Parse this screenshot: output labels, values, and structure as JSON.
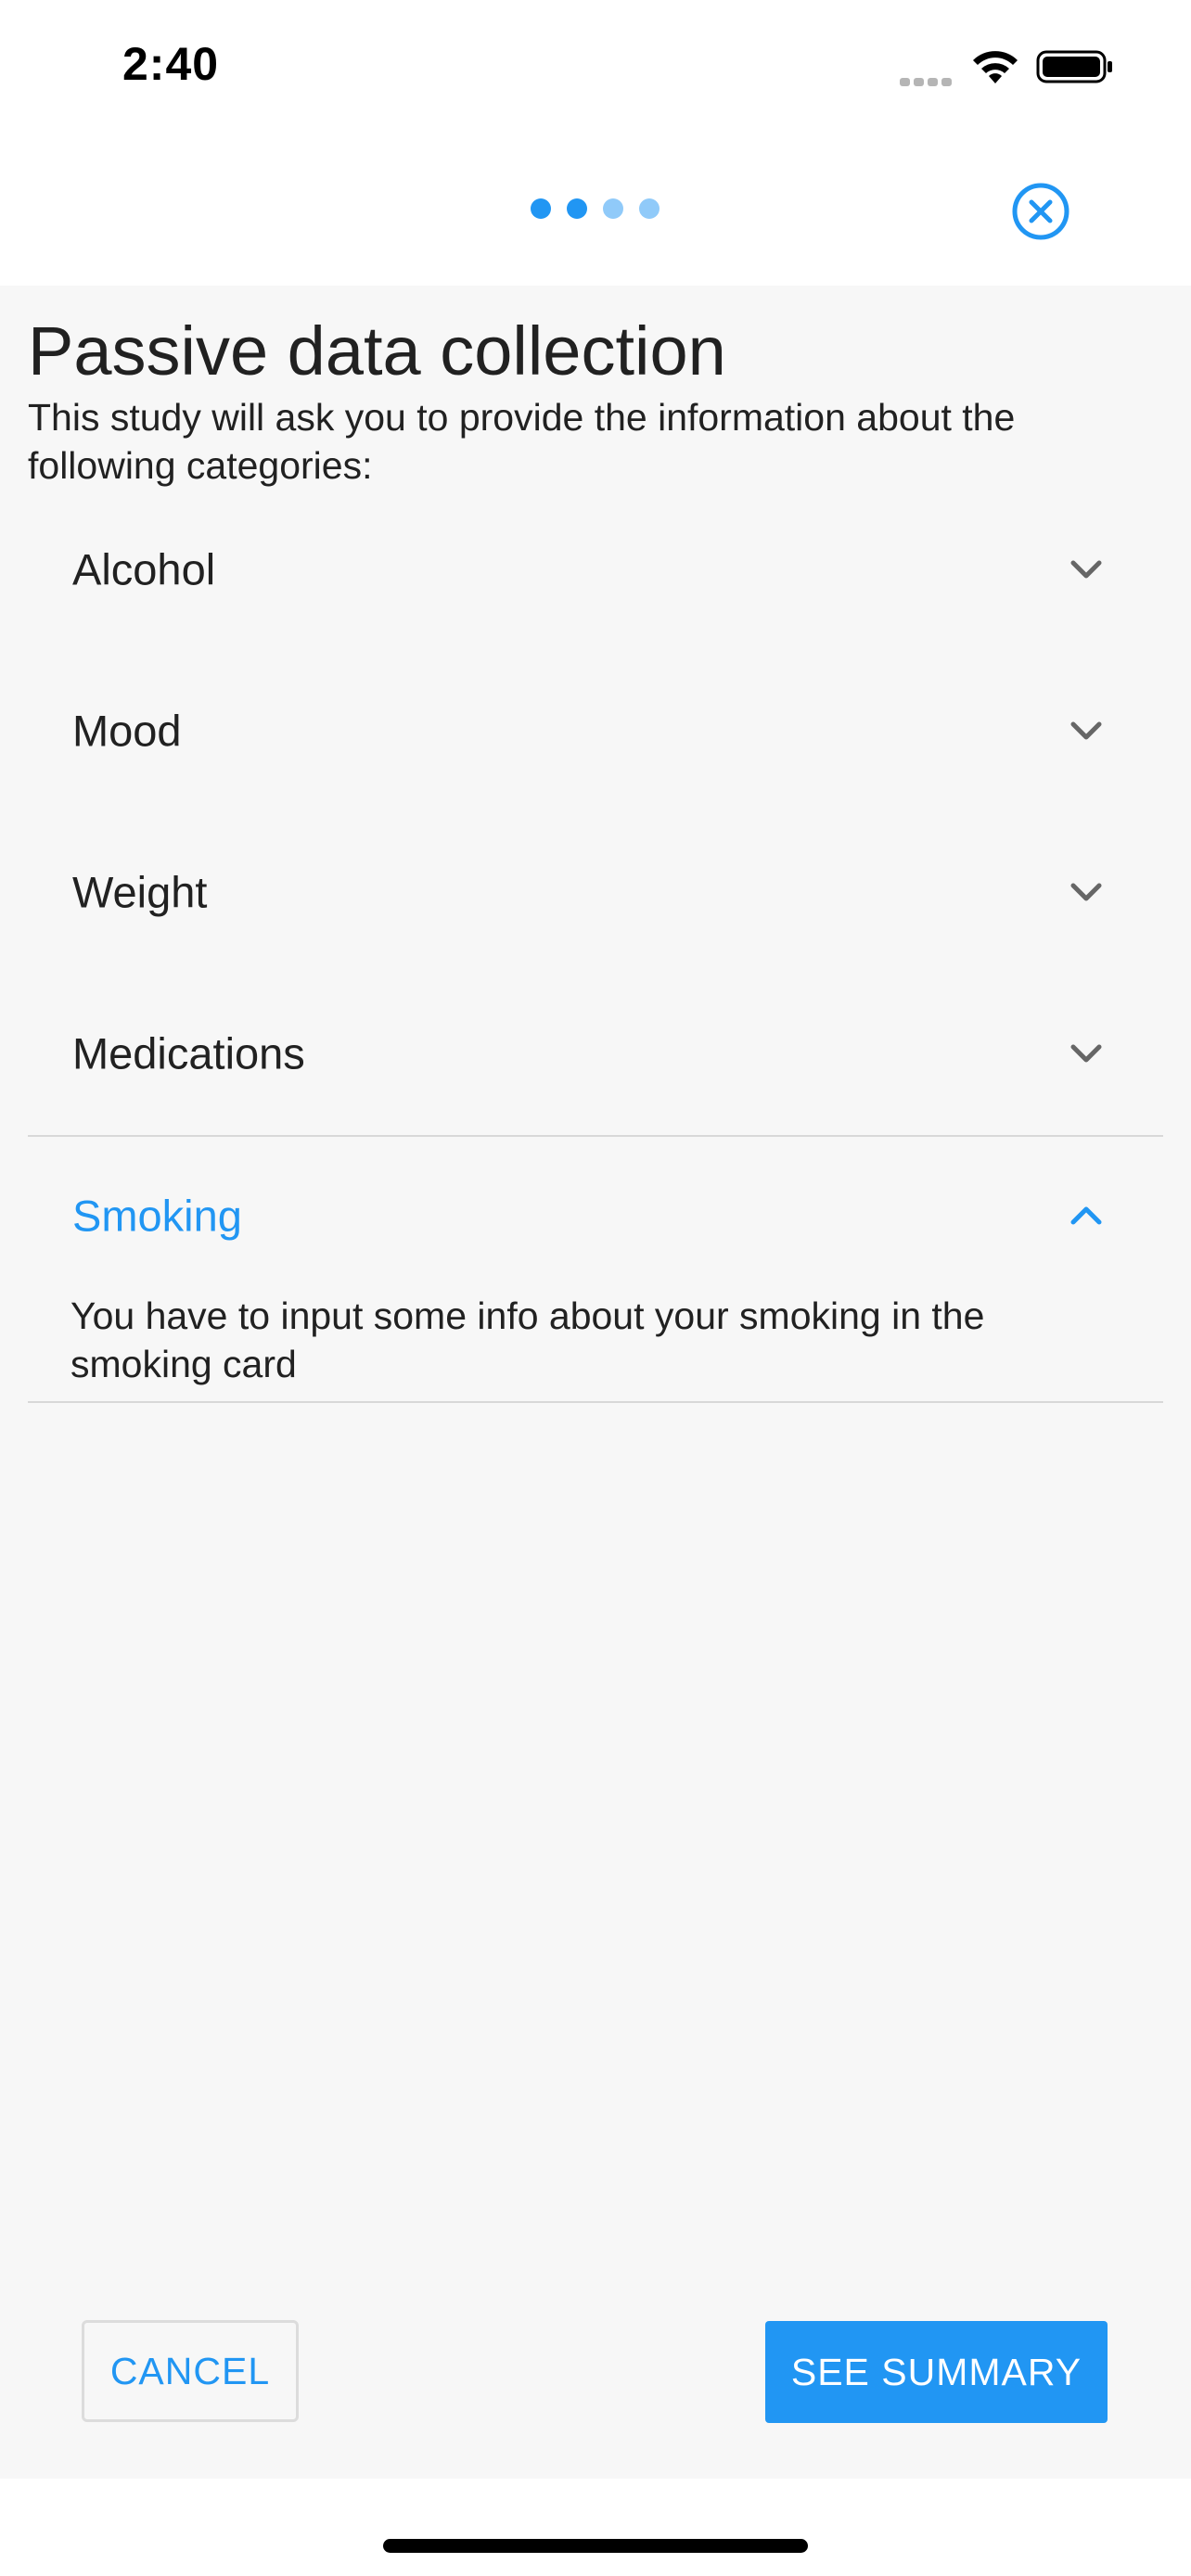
{
  "status_bar": {
    "time": "2:40"
  },
  "stepper": {
    "total_steps": 4,
    "completed_steps": 2,
    "active_color": "#2196f3",
    "inactive_color": "#90caf9"
  },
  "close_icon": "close-circle-icon",
  "page": {
    "title": "Passive data collection",
    "description": "This study will ask you to provide the information about the following categories:"
  },
  "categories": [
    {
      "label": "Alcohol",
      "expanded": false
    },
    {
      "label": "Mood",
      "expanded": false
    },
    {
      "label": "Weight",
      "expanded": false
    },
    {
      "label": "Medications",
      "expanded": false
    },
    {
      "label": "Smoking",
      "expanded": true,
      "details": "You have to input some info about your smoking in the smoking card"
    }
  ],
  "actions": {
    "cancel_label": "CANCEL",
    "summary_label": "SEE SUMMARY"
  },
  "colors": {
    "accent": "#2196f3",
    "text": "#212121",
    "background": "#f7f7f7"
  }
}
